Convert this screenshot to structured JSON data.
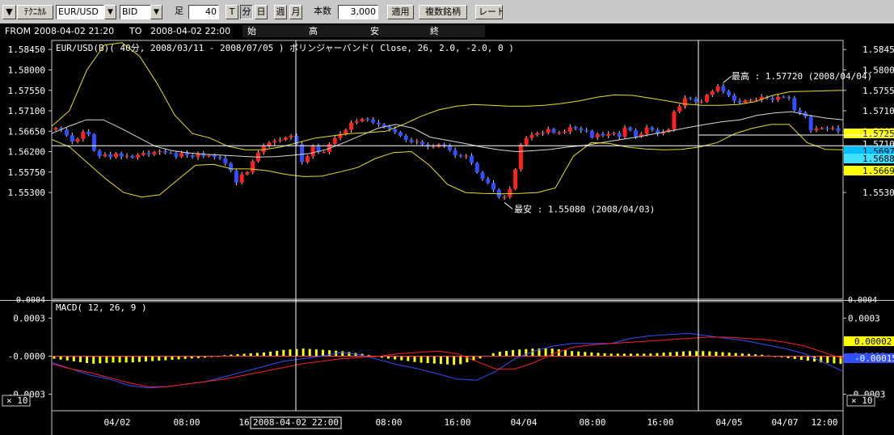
{
  "toolbar": {
    "menu_arrow": "▼",
    "technical_label": "ﾃｸﾆｶﾙ",
    "symbol": "EUR/USD",
    "dropdown_glyph": "▼",
    "side": "BID",
    "ashi_label": "足",
    "period_value": "40",
    "period_unit": "分",
    "tf_buttons": [
      "T",
      "分",
      "日",
      "週",
      "月"
    ],
    "count_label": "本数",
    "count_value": "3,000",
    "apply_label": "適用",
    "multi_label": "複数銘柄",
    "rate_label": "レート"
  },
  "infobar": {
    "from_label": "FROM",
    "from_value": "2008-04-02  21:20",
    "to_label": "TO",
    "to_value": "2008-04-02  22:00",
    "open_label": "始",
    "high_label": "高",
    "low_label": "安",
    "close_label": "終"
  },
  "colors": {
    "bg": "#000000",
    "up": "#ff2020",
    "down": "#3050ff",
    "band": "#e8e020",
    "ma": "#d8d8d8",
    "macd_line": "#3050ff",
    "signal_line": "#ff2020",
    "histogram": "#ffff00",
    "frame": "#c8c8c8"
  },
  "chart_data": [
    {
      "type": "candlestick",
      "title": "EUR/USD(B)( 40分, 2008/03/11 - 2008/07/05 )   ボリンジャーバンド( Close, 26, 2.0, -2.0, 0 )",
      "y_ticks": [
        "1.58450",
        "1.58000",
        "1.57550",
        "1.57100",
        "1.56650",
        "1.56200",
        "1.55750",
        "1.55300"
      ],
      "ylim": [
        1.5295,
        1.5865
      ],
      "high_annotation": "最高 : 1.57720 (2008/04/04)",
      "low_annotation": "最安 : 1.55080 (2008/04/03)",
      "price_tags": [
        {
          "value": "1.57259",
          "color": "#ffff00"
        },
        {
          "value": "1.57100",
          "color": "#000000"
        },
        {
          "value": "1.56978",
          "color": "#00bfff"
        },
        {
          "value": "1.56888",
          "color": "#40e0ff"
        },
        {
          "value": "1.56696",
          "color": "#ffff00"
        }
      ],
      "crosshair_price": 1.5633,
      "candle_close_path": [
        1.5672,
        1.5668,
        1.5656,
        1.5642,
        1.5648,
        1.5664,
        1.5658,
        1.5622,
        1.561,
        1.5614,
        1.5608,
        1.5616,
        1.5609,
        1.5611,
        1.5607,
        1.5613,
        1.5617,
        1.5614,
        1.5619,
        1.5621,
        1.5618,
        1.5617,
        1.5609,
        1.5617,
        1.5612,
        1.5608,
        1.5616,
        1.561,
        1.5612,
        1.5608,
        1.5605,
        1.5594,
        1.5578,
        1.5552,
        1.557,
        1.5575,
        1.5599,
        1.5618,
        1.5632,
        1.564,
        1.5644,
        1.5646,
        1.5651,
        1.5655,
        1.5636,
        1.5597,
        1.561,
        1.5632,
        1.5619,
        1.5619,
        1.5637,
        1.565,
        1.5659,
        1.5668,
        1.5684,
        1.5687,
        1.5692,
        1.5691,
        1.5684,
        1.568,
        1.5675,
        1.567,
        1.5663,
        1.5655,
        1.5646,
        1.5641,
        1.5642,
        1.5636,
        1.5631,
        1.5631,
        1.5636,
        1.5633,
        1.5623,
        1.5612,
        1.561,
        1.5611,
        1.5595,
        1.5574,
        1.556,
        1.5551,
        1.5536,
        1.552,
        1.552,
        1.5538,
        1.5581,
        1.5635,
        1.565,
        1.5657,
        1.5661,
        1.5662,
        1.567,
        1.5662,
        1.5662,
        1.5664,
        1.5674,
        1.5671,
        1.5667,
        1.5666,
        1.5651,
        1.5659,
        1.5655,
        1.5659,
        1.5661,
        1.5653,
        1.5673,
        1.5667,
        1.5653,
        1.5659,
        1.5673,
        1.5668,
        1.566,
        1.5664,
        1.5669,
        1.5708,
        1.572,
        1.5738,
        1.5737,
        1.573,
        1.573,
        1.5745,
        1.5753,
        1.5764,
        1.5753,
        1.5744,
        1.5732,
        1.5728,
        1.5733,
        1.5733,
        1.5734,
        1.5741,
        1.5738,
        1.5734,
        1.5741,
        1.574,
        1.5738,
        1.5711,
        1.5706,
        1.5697,
        1.5667,
        1.5671,
        1.5672,
        1.567,
        1.5672,
        1.5665
      ],
      "band_upper_path": [
        1.5676,
        1.571,
        1.58,
        1.5855,
        1.586,
        1.583,
        1.577,
        1.57,
        1.566,
        1.565,
        1.5632,
        1.5624,
        1.5624,
        1.563,
        1.564,
        1.565,
        1.5655,
        1.566,
        1.5662,
        1.5665,
        1.568,
        1.5698,
        1.5712,
        1.572,
        1.5724,
        1.5722,
        1.572,
        1.572,
        1.5722,
        1.5726,
        1.5732,
        1.574,
        1.5745,
        1.5744,
        1.5738,
        1.5732,
        1.5725,
        1.5722,
        1.5722,
        1.5724,
        1.573,
        1.5744,
        1.5752,
        1.5753,
        1.5754,
        1.5755
      ],
      "band_middle_path": [
        1.566,
        1.5676,
        1.569,
        1.569,
        1.5672,
        1.5652,
        1.5632,
        1.5622,
        1.5617,
        1.5614,
        1.5612,
        1.561,
        1.5608,
        1.5609,
        1.5612,
        1.5616,
        1.5625,
        1.564,
        1.5656,
        1.5672,
        1.568,
        1.5672,
        1.5652,
        1.5645,
        1.5638,
        1.563,
        1.5624,
        1.562,
        1.5622,
        1.5625,
        1.563,
        1.5634,
        1.564,
        1.5646,
        1.5652,
        1.5659,
        1.5666,
        1.5673,
        1.568,
        1.5686,
        1.569,
        1.57,
        1.5705,
        1.5708,
        1.57,
        1.5694,
        1.569
      ],
      "band_lower_path": [
        1.5647,
        1.563,
        1.5595,
        1.556,
        1.553,
        1.552,
        1.5525,
        1.5558,
        1.559,
        1.5592,
        1.5582,
        1.5582,
        1.5578,
        1.557,
        1.5565,
        1.5566,
        1.5575,
        1.5585,
        1.5605,
        1.5618,
        1.562,
        1.559,
        1.5548,
        1.553,
        1.5528,
        1.5527,
        1.5528,
        1.553,
        1.554,
        1.561,
        1.564,
        1.5638,
        1.563,
        1.5626,
        1.5624,
        1.5625,
        1.563,
        1.564,
        1.566,
        1.5672,
        1.568,
        1.568,
        1.564,
        1.5625,
        1.5624
      ]
    },
    {
      "type": "line",
      "title": "MACD( 12, 26, 9 )",
      "y_ticks": [
        "0.0003",
        "-0.0000",
        "-0.0003"
      ],
      "top_tick_partial": "0.0004",
      "ylim": [
        -0.00043,
        0.00043
      ],
      "price_tags": [
        {
          "value": "0.00002",
          "color": "#ffff00"
        },
        {
          "value": "-0.00015",
          "color": "#3050ff"
        }
      ],
      "series": [
        {
          "name": "MACD",
          "values": [
            -5e-05,
            -0.0001,
            -0.00015,
            -0.00018,
            -0.00023,
            -0.00025,
            -0.00024,
            -0.00022,
            -0.0002,
            -0.00016,
            -0.00012,
            -8e-05,
            -4e-05,
            -2e-05,
            0.0,
            3e-05,
            1e-05,
            -3e-05,
            -7e-05,
            -0.0001,
            -0.00014,
            -0.00018,
            -0.00019,
            -0.00012,
            -2e-05,
            4e-05,
            8e-05,
            0.0001,
            0.0001,
            0.0001,
            0.00014,
            0.00016,
            0.00017,
            0.00018,
            0.00016,
            0.00014,
            0.00012,
            9e-05,
            6e-05,
            2e-05,
            -5e-05,
            -0.00012
          ]
        },
        {
          "name": "Signal",
          "values": [
            -6e-05,
            -0.0001,
            -0.00013,
            -0.00017,
            -0.00021,
            -0.00024,
            -0.00024,
            -0.00022,
            -0.0002,
            -0.00018,
            -0.00015,
            -0.00012,
            -9e-05,
            -6e-05,
            -4e-05,
            -2e-05,
            -1e-05,
            0.0,
            2e-05,
            3e-05,
            4e-05,
            2e-05,
            -4e-05,
            -0.0001,
            -0.0001,
            -5e-05,
            2e-05,
            7e-05,
            9e-05,
            0.0001,
            0.00011,
            0.00012,
            0.00013,
            0.00014,
            0.00015,
            0.00015,
            0.00014,
            0.00013,
            0.00011,
            8e-05,
            3e-05,
            -2e-05
          ]
        },
        {
          "name": "Histogram",
          "values": [
            -2e-05,
            -4e-05,
            -6e-05,
            -5e-05,
            -5e-05,
            -4e-05,
            -3e-05,
            -2e-05,
            -1e-05,
            1e-05,
            2e-05,
            3e-05,
            5e-05,
            6e-05,
            5e-05,
            4e-05,
            2e-05,
            -1e-05,
            -3e-05,
            -5e-05,
            -6e-05,
            -7e-05,
            -3e-05,
            3e-05,
            5e-05,
            6e-05,
            6e-05,
            4e-05,
            3e-05,
            2e-05,
            2e-05,
            2e-05,
            3e-05,
            4e-05,
            4e-05,
            3e-05,
            2e-05,
            1e-05,
            -1e-05,
            -3e-05,
            -5e-05,
            -6e-05
          ]
        }
      ]
    }
  ],
  "x_axis": {
    "labels": [
      "04/02",
      "08:00",
      "16",
      "08:00",
      "16:00",
      "04/04",
      "08:00",
      "16:00",
      "04/05",
      "04/07",
      "12:00"
    ],
    "crosshair_time": "2008-04-02  22:00"
  },
  "scale_buttons": [
    "× 10",
    "× 10"
  ]
}
